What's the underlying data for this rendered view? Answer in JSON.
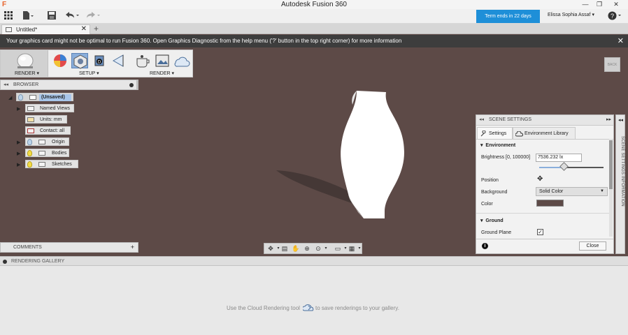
{
  "window": {
    "title": "Autodesk Fusion 360",
    "app_icon": "fusion-logo-icon",
    "controls": [
      "minimize-icon",
      "restore-icon",
      "close-icon"
    ]
  },
  "toolbar": {
    "icons": [
      "grid-menu-icon",
      "file-icon",
      "save-icon",
      "undo-icon",
      "redo-icon"
    ],
    "trial_text": "Term ends in 22 days",
    "user_name": "Elissa Sophia Assaf",
    "help_icon": "help-icon"
  },
  "tab": {
    "label": "Untitled*",
    "close": "✕",
    "add": "+"
  },
  "warning": {
    "message": "Your graphics card might not be optimal to run Fusion 360. Open Graphics Diagnostic from the help menu ('?' button in the top right corner) for more information",
    "close": "✕"
  },
  "ribbon": {
    "workspace_label": "RENDER ▾",
    "setup_label": "SETUP ▾",
    "render_label": "RENDER ▾"
  },
  "viewcube": {
    "label": "BACK"
  },
  "browser": {
    "title": "BROWSER",
    "root": "(Unsaved)",
    "items": [
      {
        "label": "Named Views"
      },
      {
        "label": "Units: mm"
      },
      {
        "label": "Contact: all"
      },
      {
        "label": "Origin"
      },
      {
        "label": "Bodies"
      },
      {
        "label": "Sketches"
      }
    ]
  },
  "comments": {
    "title": "COMMENTS",
    "add": "+"
  },
  "scene_settings": {
    "title": "SCENE SETTINGS",
    "tabs": [
      "Settings",
      "Environment Library"
    ],
    "environment_header": "Environment",
    "brightness_label": "Brightness [0, 100000]",
    "brightness_value": "7536.232 lx",
    "brightness_fraction": 0.38,
    "position_label": "Position",
    "background_label": "Background",
    "background_value": "Solid Color",
    "color_label": "Color",
    "color_value": "#5d4a47",
    "ground_header": "Ground",
    "ground_plane_label": "Ground Plane",
    "ground_plane_checked": true,
    "close_label": "Close"
  },
  "side_strip": {
    "label": "SCENE SETTINGS INFORMATION"
  },
  "gallery": {
    "title": "RENDERING GALLERY",
    "message_before": "Use the Cloud Rendering tool",
    "message_after": "to save renderings to your gallery."
  },
  "colors": {
    "viewport": "#5d4a47",
    "accent": "#1e8fd8",
    "warning_bar": "#3d3d3d"
  }
}
